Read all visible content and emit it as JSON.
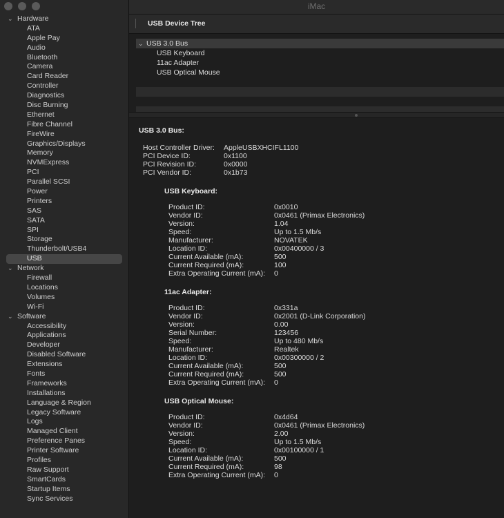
{
  "window": {
    "title": "iMac"
  },
  "toolbar": {
    "title": "USB Device Tree"
  },
  "sidebar": {
    "groups": [
      {
        "label": "Hardware",
        "items": [
          "ATA",
          "Apple Pay",
          "Audio",
          "Bluetooth",
          "Camera",
          "Card Reader",
          "Controller",
          "Diagnostics",
          "Disc Burning",
          "Ethernet",
          "Fibre Channel",
          "FireWire",
          "Graphics/Displays",
          "Memory",
          "NVMExpress",
          "PCI",
          "Parallel SCSI",
          "Power",
          "Printers",
          "SAS",
          "SATA",
          "SPI",
          "Storage",
          "Thunderbolt/USB4",
          "USB"
        ]
      },
      {
        "label": "Network",
        "items": [
          "Firewall",
          "Locations",
          "Volumes",
          "Wi-Fi"
        ]
      },
      {
        "label": "Software",
        "items": [
          "Accessibility",
          "Applications",
          "Developer",
          "Disabled Software",
          "Extensions",
          "Fonts",
          "Frameworks",
          "Installations",
          "Language & Region",
          "Legacy Software",
          "Logs",
          "Managed Client",
          "Preference Panes",
          "Printer Software",
          "Profiles",
          "Raw Support",
          "SmartCards",
          "Startup Items",
          "Sync Services"
        ]
      }
    ],
    "selected": "USB"
  },
  "device_tree": {
    "rows": [
      {
        "label": "USB 3.0 Bus",
        "level": 0,
        "expanded": true
      },
      {
        "label": "USB Keyboard",
        "level": 1
      },
      {
        "label": "11ac Adapter",
        "level": 1
      },
      {
        "label": "USB Optical Mouse",
        "level": 1
      }
    ]
  },
  "details": {
    "bus_title": "USB 3.0 Bus:",
    "bus_props": [
      {
        "k": "Host Controller Driver:",
        "v": "AppleUSBXHCIFL1100"
      },
      {
        "k": "PCI Device ID:",
        "v": "0x1100"
      },
      {
        "k": "PCI Revision ID:",
        "v": "0x0000"
      },
      {
        "k": "PCI Vendor ID:",
        "v": "0x1b73"
      }
    ],
    "devices": [
      {
        "title": "USB Keyboard:",
        "props": [
          {
            "k": "Product ID:",
            "v": "0x0010"
          },
          {
            "k": "Vendor ID:",
            "v": "0x0461  (Primax Electronics)"
          },
          {
            "k": "Version:",
            "v": "1.04"
          },
          {
            "k": "Speed:",
            "v": "Up to 1.5 Mb/s"
          },
          {
            "k": "Manufacturer:",
            "v": "NOVATEK"
          },
          {
            "k": "Location ID:",
            "v": "0x00400000 / 3"
          },
          {
            "k": "Current Available (mA):",
            "v": "500"
          },
          {
            "k": "Current Required (mA):",
            "v": "100"
          },
          {
            "k": "Extra Operating Current (mA):",
            "v": "0"
          }
        ]
      },
      {
        "title": "11ac Adapter:",
        "props": [
          {
            "k": "Product ID:",
            "v": "0x331a"
          },
          {
            "k": "Vendor ID:",
            "v": "0x2001  (D-Link Corporation)"
          },
          {
            "k": "Version:",
            "v": "0.00"
          },
          {
            "k": "Serial Number:",
            "v": "123456"
          },
          {
            "k": "Speed:",
            "v": "Up to 480 Mb/s"
          },
          {
            "k": "Manufacturer:",
            "v": "Realtek"
          },
          {
            "k": "Location ID:",
            "v": "0x00300000 / 2"
          },
          {
            "k": "Current Available (mA):",
            "v": "500"
          },
          {
            "k": "Current Required (mA):",
            "v": "500"
          },
          {
            "k": "Extra Operating Current (mA):",
            "v": "0"
          }
        ]
      },
      {
        "title": "USB Optical Mouse:",
        "props": [
          {
            "k": "Product ID:",
            "v": "0x4d64"
          },
          {
            "k": "Vendor ID:",
            "v": "0x0461  (Primax Electronics)"
          },
          {
            "k": "Version:",
            "v": "2.00"
          },
          {
            "k": "Speed:",
            "v": "Up to 1.5 Mb/s"
          },
          {
            "k": "Location ID:",
            "v": "0x00100000 / 1"
          },
          {
            "k": "Current Available (mA):",
            "v": "500"
          },
          {
            "k": "Current Required (mA):",
            "v": "98"
          },
          {
            "k": "Extra Operating Current (mA):",
            "v": "0"
          }
        ]
      }
    ]
  }
}
